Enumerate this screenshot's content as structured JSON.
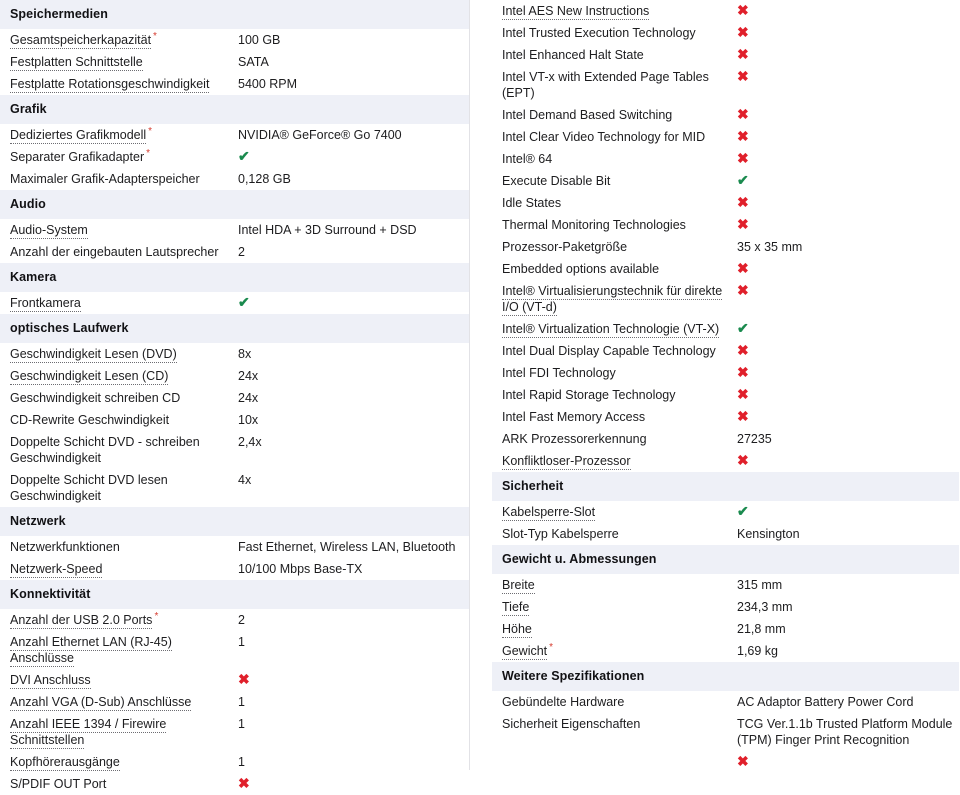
{
  "meta": {
    "colors": {
      "section_header_bg": "#eef0f7",
      "row_bg": "#ffffff",
      "text": "#1d1d1f",
      "check_green": "#1a8a4e",
      "cross_red": "#e0202b",
      "required_star_red": "#d63b2f",
      "divider": "#e2e2e6"
    },
    "icons": {
      "check": "✔",
      "cross": "✖"
    }
  },
  "left_column": {
    "sections": [
      {
        "title": "Speichermedien",
        "rows": [
          {
            "label": "Gesamtspeicherkapazität",
            "tooltip": true,
            "required": true,
            "value": "100 GB",
            "type": "text"
          },
          {
            "label": "Festplatten Schnittstelle",
            "tooltip": true,
            "required": false,
            "value": "SATA",
            "type": "text"
          },
          {
            "label": "Festplatte Rotationsgeschwindigkeit",
            "tooltip": true,
            "required": false,
            "value": "5400 RPM",
            "type": "text"
          }
        ]
      },
      {
        "title": "Grafik",
        "rows": [
          {
            "label": "Dediziertes Grafikmodell",
            "tooltip": true,
            "required": true,
            "value": "NVIDIA® GeForce® Go 7400",
            "type": "text"
          },
          {
            "label": "Separater Grafikadapter",
            "tooltip": false,
            "required": true,
            "value": "check",
            "type": "mark"
          },
          {
            "label": "Maximaler Grafik-Adapterspeicher",
            "tooltip": false,
            "required": false,
            "value": "0,128 GB",
            "type": "text"
          }
        ]
      },
      {
        "title": "Audio",
        "rows": [
          {
            "label": "Audio-System",
            "tooltip": true,
            "required": false,
            "value": "Intel HDA + 3D Surround + DSD",
            "type": "text"
          },
          {
            "label": "Anzahl der eingebauten Lautsprecher",
            "tooltip": false,
            "required": false,
            "value": "2",
            "type": "text"
          }
        ]
      },
      {
        "title": "Kamera",
        "rows": [
          {
            "label": "Frontkamera",
            "tooltip": true,
            "required": false,
            "value": "check",
            "type": "mark"
          }
        ]
      },
      {
        "title": "optisches Laufwerk",
        "rows": [
          {
            "label": "Geschwindigkeit Lesen (DVD)",
            "tooltip": true,
            "required": false,
            "value": "8x",
            "type": "text"
          },
          {
            "label": "Geschwindigkeit Lesen (CD)",
            "tooltip": true,
            "required": false,
            "value": "24x",
            "type": "text"
          },
          {
            "label": "Geschwindigkeit schreiben CD",
            "tooltip": false,
            "required": false,
            "value": "24x",
            "type": "text"
          },
          {
            "label": "CD-Rewrite Geschwindigkeit",
            "tooltip": false,
            "required": false,
            "value": "10x",
            "type": "text"
          },
          {
            "label": "Doppelte Schicht DVD - schreiben Geschwindigkeit",
            "tooltip": false,
            "required": false,
            "value": "2,4x",
            "type": "text"
          },
          {
            "label": "Doppelte Schicht DVD lesen Geschwindigkeit",
            "tooltip": false,
            "required": false,
            "value": "4x",
            "type": "text"
          }
        ]
      },
      {
        "title": "Netzwerk",
        "rows": [
          {
            "label": "Netzwerkfunktionen",
            "tooltip": false,
            "required": false,
            "value": "Fast Ethernet, Wireless LAN, Bluetooth",
            "type": "text"
          },
          {
            "label": "Netzwerk-Speed",
            "tooltip": true,
            "required": false,
            "value": "10/100 Mbps Base-TX",
            "type": "text"
          }
        ]
      },
      {
        "title": "Konnektivität",
        "rows": [
          {
            "label": "Anzahl der USB 2.0 Ports",
            "tooltip": true,
            "required": true,
            "value": "2",
            "type": "text"
          },
          {
            "label": "Anzahl Ethernet LAN (RJ-45) Anschlüsse",
            "tooltip": true,
            "required": false,
            "value": "1",
            "type": "text"
          },
          {
            "label": "DVI Anschluss",
            "tooltip": true,
            "required": false,
            "value": "cross",
            "type": "mark"
          },
          {
            "label": "Anzahl VGA (D-Sub) Anschlüsse",
            "tooltip": true,
            "required": false,
            "value": "1",
            "type": "text"
          },
          {
            "label": "Anzahl IEEE 1394 / Firewire Schnittstellen",
            "tooltip": true,
            "required": false,
            "value": "1",
            "type": "text"
          },
          {
            "label": "Kopfhörerausgänge",
            "tooltip": true,
            "required": false,
            "value": "1",
            "type": "text"
          },
          {
            "label": "S/PDIF OUT Port",
            "tooltip": false,
            "required": false,
            "value": "cross",
            "type": "mark"
          }
        ]
      }
    ]
  },
  "right_column": {
    "sections": [
      {
        "title": "",
        "rows": [
          {
            "label": "Intel AES New Instructions",
            "tooltip": true,
            "required": false,
            "value": "cross",
            "type": "mark"
          },
          {
            "label": "Intel Trusted Execution Technology",
            "tooltip": false,
            "required": false,
            "value": "cross",
            "type": "mark"
          },
          {
            "label": "Intel Enhanced Halt State",
            "tooltip": false,
            "required": false,
            "value": "cross",
            "type": "mark"
          },
          {
            "label": "Intel VT-x with Extended Page Tables (EPT)",
            "tooltip": false,
            "required": false,
            "value": "cross",
            "type": "mark"
          },
          {
            "label": "Intel Demand Based Switching",
            "tooltip": false,
            "required": false,
            "value": "cross",
            "type": "mark"
          },
          {
            "label": "Intel Clear Video Technology for MID",
            "tooltip": false,
            "required": false,
            "value": "cross",
            "type": "mark"
          },
          {
            "label": "Intel® 64",
            "tooltip": false,
            "required": false,
            "value": "cross",
            "type": "mark"
          },
          {
            "label": "Execute Disable Bit",
            "tooltip": false,
            "required": false,
            "value": "check",
            "type": "mark"
          },
          {
            "label": "Idle States",
            "tooltip": false,
            "required": false,
            "value": "cross",
            "type": "mark"
          },
          {
            "label": "Thermal Monitoring Technologies",
            "tooltip": false,
            "required": false,
            "value": "cross",
            "type": "mark"
          },
          {
            "label": "Prozessor-Paketgröße",
            "tooltip": false,
            "required": false,
            "value": "35 x 35 mm",
            "type": "text"
          },
          {
            "label": "Embedded options available",
            "tooltip": false,
            "required": false,
            "value": "cross",
            "type": "mark"
          },
          {
            "label": "Intel® Virtualisierungstechnik für direkte I/O (VT-d)",
            "tooltip": true,
            "required": false,
            "value": "cross",
            "type": "mark"
          },
          {
            "label": "Intel® Virtualization Technologie (VT-X)",
            "tooltip": true,
            "required": false,
            "value": "check",
            "type": "mark"
          },
          {
            "label": "Intel Dual Display Capable Technology",
            "tooltip": false,
            "required": false,
            "value": "cross",
            "type": "mark"
          },
          {
            "label": "Intel FDI Technology",
            "tooltip": false,
            "required": false,
            "value": "cross",
            "type": "mark"
          },
          {
            "label": "Intel Rapid Storage Technology",
            "tooltip": false,
            "required": false,
            "value": "cross",
            "type": "mark"
          },
          {
            "label": "Intel Fast Memory Access",
            "tooltip": false,
            "required": false,
            "value": "cross",
            "type": "mark"
          },
          {
            "label": "ARK Prozessorerkennung",
            "tooltip": false,
            "required": false,
            "value": "27235",
            "type": "text"
          },
          {
            "label": "Konfliktloser-Prozessor",
            "tooltip": true,
            "required": false,
            "value": "cross",
            "type": "mark"
          }
        ]
      },
      {
        "title": "Sicherheit",
        "rows": [
          {
            "label": "Kabelsperre-Slot",
            "tooltip": true,
            "required": false,
            "value": "check",
            "type": "mark"
          },
          {
            "label": "Slot-Typ Kabelsperre",
            "tooltip": false,
            "required": false,
            "value": "Kensington",
            "type": "text"
          }
        ]
      },
      {
        "title": "Gewicht u. Abmessungen",
        "rows": [
          {
            "label": "Breite",
            "tooltip": true,
            "required": false,
            "value": "315 mm",
            "type": "text"
          },
          {
            "label": "Tiefe",
            "tooltip": true,
            "required": false,
            "value": "234,3 mm",
            "type": "text"
          },
          {
            "label": "Höhe",
            "tooltip": true,
            "required": false,
            "value": "21,8 mm",
            "type": "text"
          },
          {
            "label": "Gewicht",
            "tooltip": true,
            "required": true,
            "value": "1,69 kg",
            "type": "text"
          }
        ]
      },
      {
        "title": "Weitere Spezifikationen",
        "rows": [
          {
            "label": "Gebündelte Hardware",
            "tooltip": false,
            "required": false,
            "value": "AC Adaptor Battery Power Cord",
            "type": "text"
          },
          {
            "label": "Sicherheit Eigenschaften",
            "tooltip": false,
            "required": false,
            "value": "TCG Ver.1.1b Trusted Platform Module (TPM) Finger Print Recognition",
            "type": "text"
          },
          {
            "label": "",
            "tooltip": false,
            "required": false,
            "value": "cross",
            "type": "mark",
            "clipped": true
          }
        ]
      }
    ]
  }
}
